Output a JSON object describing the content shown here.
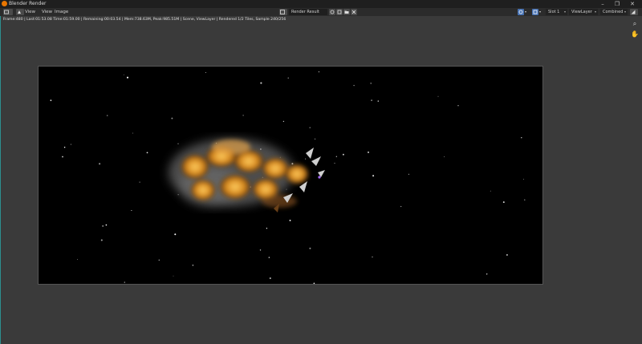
{
  "window": {
    "title": "Blender Render"
  },
  "menu": {
    "view": "View",
    "view2": "View",
    "image": "Image"
  },
  "image_selector": {
    "name": "Render Result"
  },
  "render_settings": {
    "slot": "Slot 1",
    "layer": "ViewLayer",
    "pass": "Combined"
  },
  "status_line": "Frame:480 | Last:01:53.08 Time:01:59.00 | Remaining:00:03.54 | Mem:738.63M, Peak:985.51M | Scene, ViewLayer | Rendered 1/2 Tiles, Sample 240/256",
  "colors": {
    "accent": "#4772b3",
    "blender_orange": "#ea7600",
    "background": "#3a3a3a"
  }
}
